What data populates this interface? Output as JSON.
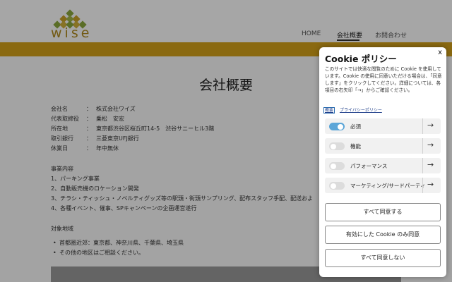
{
  "header": {
    "logo_text": "wise",
    "nav": [
      "HOME",
      "会社概要",
      "お問合わせ"
    ],
    "brand_color": "#d4a21a"
  },
  "main": {
    "title": "会社概要",
    "info": [
      {
        "k": "会社名",
        "v": "株式会社ワイズ"
      },
      {
        "k": "代表取締役",
        "v": "乗松　安宏"
      },
      {
        "k": "所在地",
        "v": "東京都渋谷区桜丘町14-5　渋谷サニーヒル3階"
      },
      {
        "k": "取引銀行",
        "v": "三菱東京UFJ銀行"
      },
      {
        "k": "休業日",
        "v": "年中無休"
      }
    ],
    "business_title": "事業内容",
    "business": [
      "1、パーキング事業",
      "2、自動販売機のロケーション開発",
      "3、チラシ・ティッシュ・ノベルティグッズ等の駅頭・街頭サンプリング、配布スタッフ手配、配送およ",
      "4、各種イベント、催事、SPキャンペーンの企画運営遂行"
    ],
    "area_title": "対象地域",
    "areas": [
      "首都圏近郊：東京都、神奈川県、千葉県、埼玉県",
      "その他の地区はご相談ください。"
    ]
  },
  "cookie": {
    "title": "Cookie ポリシー",
    "close": "x",
    "description": "このサイトでは快適な閲覧のために Cookie を使用しています。Cookie の使用に同意いただける場合は、「同意します」をクリックしてください。詳細については、各項目の右矢印「→」からご確認ください。",
    "links": [
      "概要",
      "プライバシーポリシー"
    ],
    "categories": [
      {
        "label": "必須",
        "on": true
      },
      {
        "label": "機能",
        "on": false
      },
      {
        "label": "パフォーマンス",
        "on": false
      },
      {
        "label": "マーケティング/サードパーティ",
        "on": false
      }
    ],
    "arrow": "→",
    "buttons": {
      "accept_all": "すべて同意する",
      "accept_selected": "有効にした Cookie のみ同意",
      "reject_all": "すべて同意しない"
    }
  }
}
